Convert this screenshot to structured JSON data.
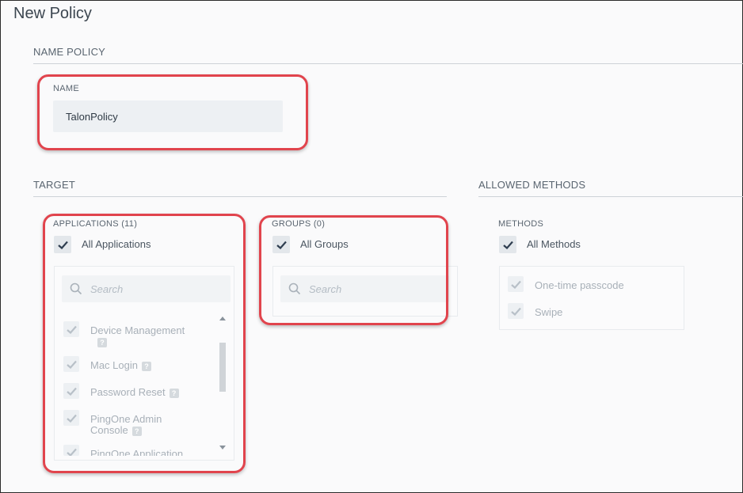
{
  "page": {
    "title": "New Policy"
  },
  "name_policy": {
    "section_title": "NAME POLICY",
    "name_label": "NAME",
    "name_value": "TalonPolicy"
  },
  "target": {
    "section_title": "TARGET",
    "applications": {
      "label": "APPLICATIONS (11)",
      "all_label": "All Applications",
      "search_placeholder": "Search",
      "items": [
        {
          "label": "Device Management",
          "help": "?"
        },
        {
          "label": "Mac Login",
          "help": "?"
        },
        {
          "label": "Password Reset",
          "help": "?"
        },
        {
          "label_line1": "PingOne Admin",
          "label_line2": "Console",
          "help": "?"
        },
        {
          "label": "PingOne Application"
        }
      ]
    },
    "groups": {
      "label": "GROUPS (0)",
      "all_label": "All Groups",
      "search_placeholder": "Search"
    }
  },
  "allowed_methods": {
    "section_title": "ALLOWED METHODS",
    "methods_label": "METHODS",
    "all_label": "All Methods",
    "items": [
      {
        "label": "One-time passcode"
      },
      {
        "label": "Swipe"
      }
    ]
  },
  "colors": {
    "highlight": "#e1444d",
    "check": "#2f3e50",
    "dim_check": "#b8c0c8"
  }
}
